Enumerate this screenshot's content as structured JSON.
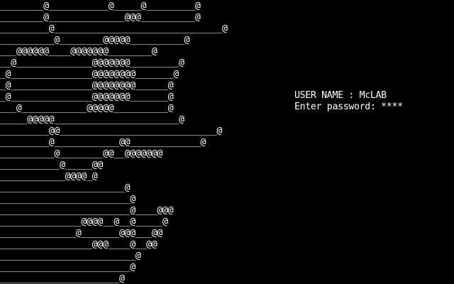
{
  "colors": {
    "background": "#000000",
    "foreground": "#ffffff"
  },
  "ascii_art": [
    "________@___________@_____@_________@",
    "________@______________@@@__________@",
    "_________@_______________________________@",
    "__________@________@@@@@__________@",
    "___@@@@@@____@@@@@@@________@",
    "__@______________@@@@@@@_________@",
    "_@_______________@@@@@@@@_______@",
    "_@_______________@@@@@@@@______@",
    "_@_______________@@@@@@@_______@",
    "___@____________@@@@@__________@",
    "_____@@@@@_______________________@",
    "_________@@_____________________________@",
    "_________@____________@@_____________@",
    "__________@________@@__@@@@@@@",
    "___________@_____@@",
    "____________@@@@_@",
    "_______________________@",
    "________________________@",
    "________________________@____@@@",
    "_______________@@@@__@__@_____@",
    "______________@_______@@@___@@",
    "_________________@@@____@__@@",
    "_________________________@",
    "________________________@",
    "______________________@"
  ],
  "login": {
    "username_label": "USER NAME : McLAB",
    "password_label": "Enter password: ****"
  }
}
